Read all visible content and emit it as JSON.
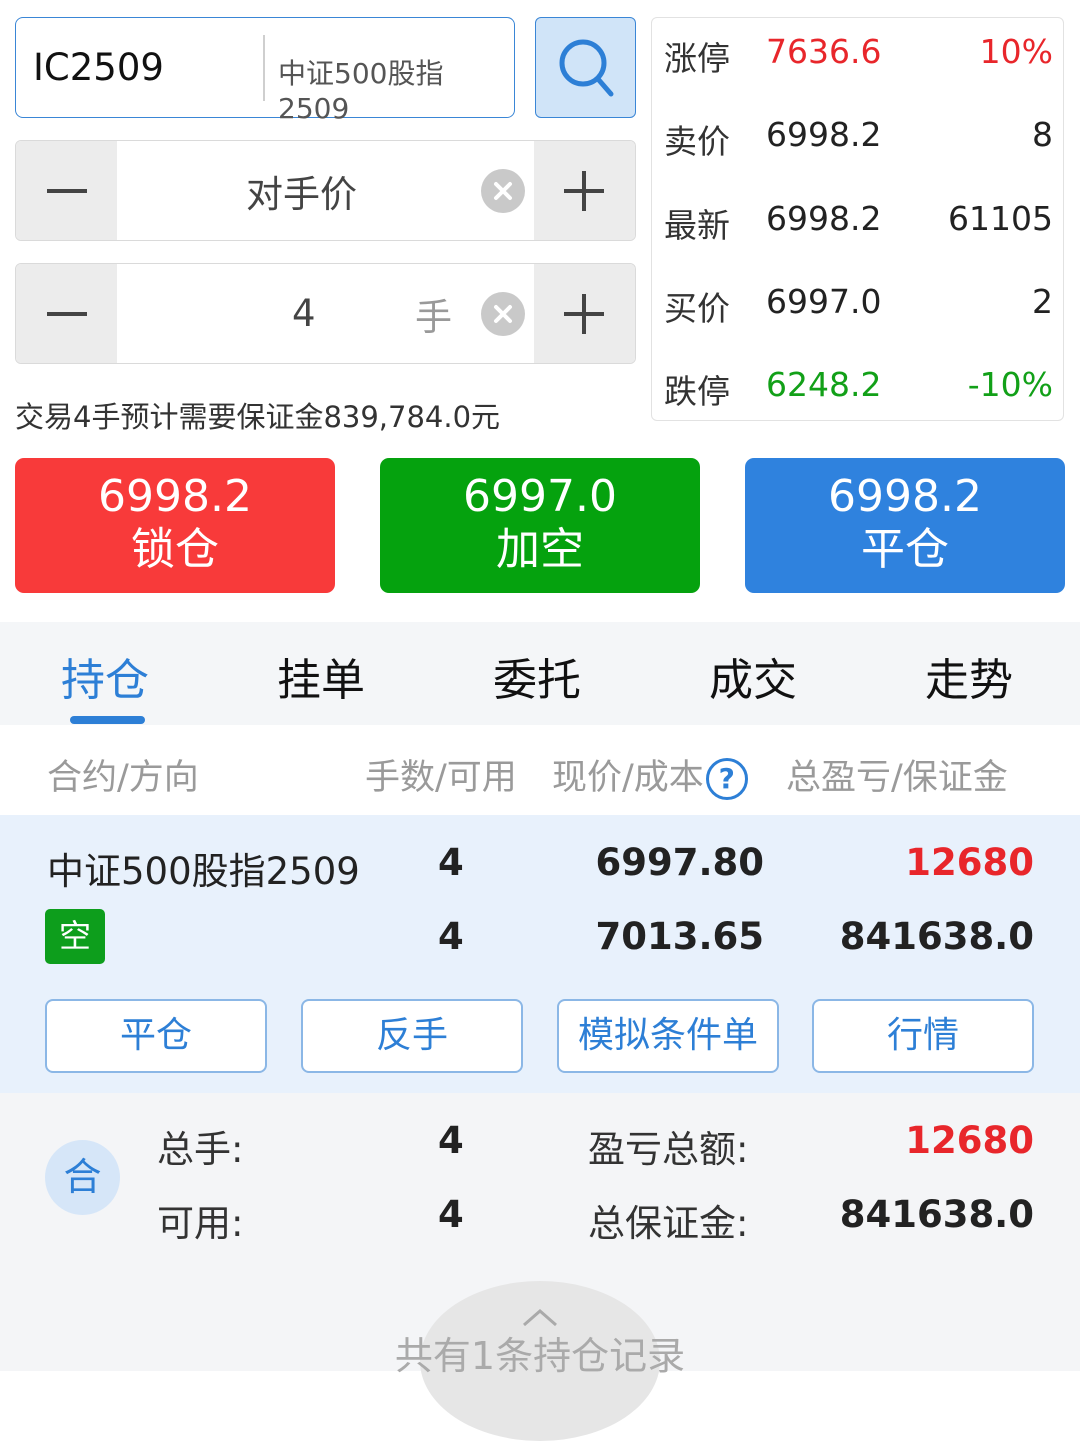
{
  "order_form": {
    "contract_code": "IC2509",
    "contract_name": "中证500股指2509",
    "price_type": "对手价",
    "quantity": "4",
    "quantity_unit": "手",
    "margin_note": "交易4手预计需要保证金839,784.0元"
  },
  "quote": {
    "limit_up": {
      "label": "涨停",
      "price": "7636.6",
      "extra": "10%"
    },
    "ask": {
      "label": "卖价",
      "price": "6998.2",
      "extra": "8"
    },
    "last": {
      "label": "最新",
      "price": "6998.2",
      "extra": "61105"
    },
    "bid": {
      "label": "买价",
      "price": "6997.0",
      "extra": "2"
    },
    "limit_down": {
      "label": "跌停",
      "price": "6248.2",
      "extra": "-10%"
    }
  },
  "actions": {
    "lock": {
      "price": "6998.2",
      "label": "锁仓",
      "color": "#f83a3a"
    },
    "short": {
      "price": "6997.0",
      "label": "加空",
      "color": "#05a20e"
    },
    "close": {
      "price": "6998.2",
      "label": "平仓",
      "color": "#2f82de"
    }
  },
  "tabs": [
    "持仓",
    "挂单",
    "委托",
    "成交",
    "走势"
  ],
  "columns": {
    "contract": "合约/方向",
    "lots": "手数/可用",
    "price": "现价/成本",
    "pnl": "总盈亏/保证金"
  },
  "position": {
    "name": "中证500股指2509",
    "direction": "空",
    "lots": "4",
    "available": "4",
    "current_price": "6997.80",
    "cost": "7013.65",
    "pnl": "12680",
    "margin": "841638.0",
    "buttons": [
      "平仓",
      "反手",
      "模拟条件单",
      "行情"
    ]
  },
  "summary": {
    "badge": "合",
    "total_lots_label": "总手:",
    "total_lots": "4",
    "available_label": "可用:",
    "available": "4",
    "pnl_label": "盈亏总额:",
    "pnl": "12680",
    "margin_label": "总保证金:",
    "margin": "841638.0",
    "footer": "共有1条持仓记录"
  },
  "colors": {
    "accent": "#2d7fd6",
    "up": "#e8262b",
    "down": "#12a018"
  }
}
